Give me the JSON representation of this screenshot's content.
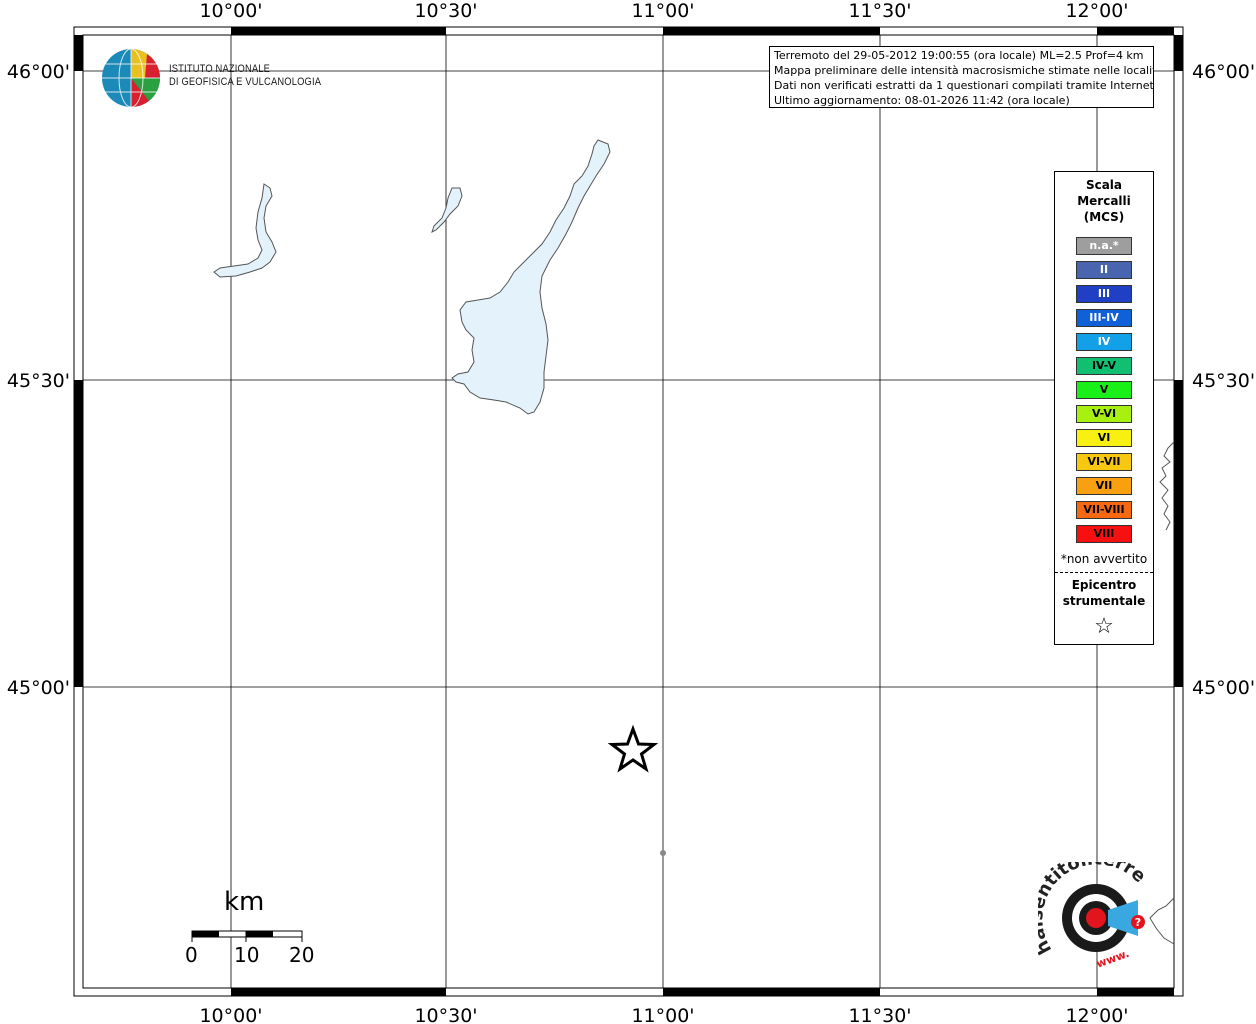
{
  "map": {
    "lon_labels": [
      "10°00'",
      "10°30'",
      "11°00'",
      "11°30'",
      "12°00'"
    ],
    "lat_labels": [
      "46°00'",
      "45°30'",
      "45°00'"
    ]
  },
  "info": {
    "line1": "Terremoto del 29-05-2012 19:00:55 (ora locale) ML=2.5 Prof=4 km",
    "line2": "Mappa preliminare delle intensità macrosismiche stimate nelle località",
    "line3": "Dati non verificati estratti da 1 questionari compilati tramite Internet.",
    "line4": "Ultimo aggiornamento: 08-01-2026 11:42 (ora locale)"
  },
  "logo": {
    "line1": "ISTITUTO NAZIONALE",
    "line2": "DI GEOFISICA E VULCANOLOGIA"
  },
  "legend": {
    "title_1": "Scala",
    "title_2": "Mercalli",
    "title_3": "(MCS)",
    "items": [
      {
        "label": "n.a.*",
        "color": "#9e9e9e",
        "text_color": "#ffffff"
      },
      {
        "label": "II",
        "color": "#4a65b0",
        "text_color": "#ffffff"
      },
      {
        "label": "III",
        "color": "#1f3fc4",
        "text_color": "#ffffff"
      },
      {
        "label": "III-IV",
        "color": "#1060d8",
        "text_color": "#ffffff"
      },
      {
        "label": "IV",
        "color": "#12a0e8",
        "text_color": "#ffffff"
      },
      {
        "label": "IV-V",
        "color": "#10c070",
        "text_color": "#000000"
      },
      {
        "label": "V",
        "color": "#18f018",
        "text_color": "#000000"
      },
      {
        "label": "V-VI",
        "color": "#a8f010",
        "text_color": "#000000"
      },
      {
        "label": "VI",
        "color": "#f8f010",
        "text_color": "#000000"
      },
      {
        "label": "VI-VII",
        "color": "#f8c810",
        "text_color": "#000000"
      },
      {
        "label": "VII",
        "color": "#f8a010",
        "text_color": "#000000"
      },
      {
        "label": "VII-VIII",
        "color": "#f86810",
        "text_color": "#000000"
      },
      {
        "label": "VIII",
        "color": "#f81010",
        "text_color": "#000000"
      }
    ],
    "note": "*non avvertito",
    "epi_1": "Epicentro",
    "epi_2": "strumentale",
    "star": "☆"
  },
  "scalebar": {
    "unit": "km",
    "ticks": [
      "0",
      "10",
      "20"
    ]
  },
  "hst": {
    "text": "haisentitoilterremoto.it",
    "www": "www."
  },
  "colors": {
    "lake": "#e4f2fb",
    "frame": "#000000"
  }
}
